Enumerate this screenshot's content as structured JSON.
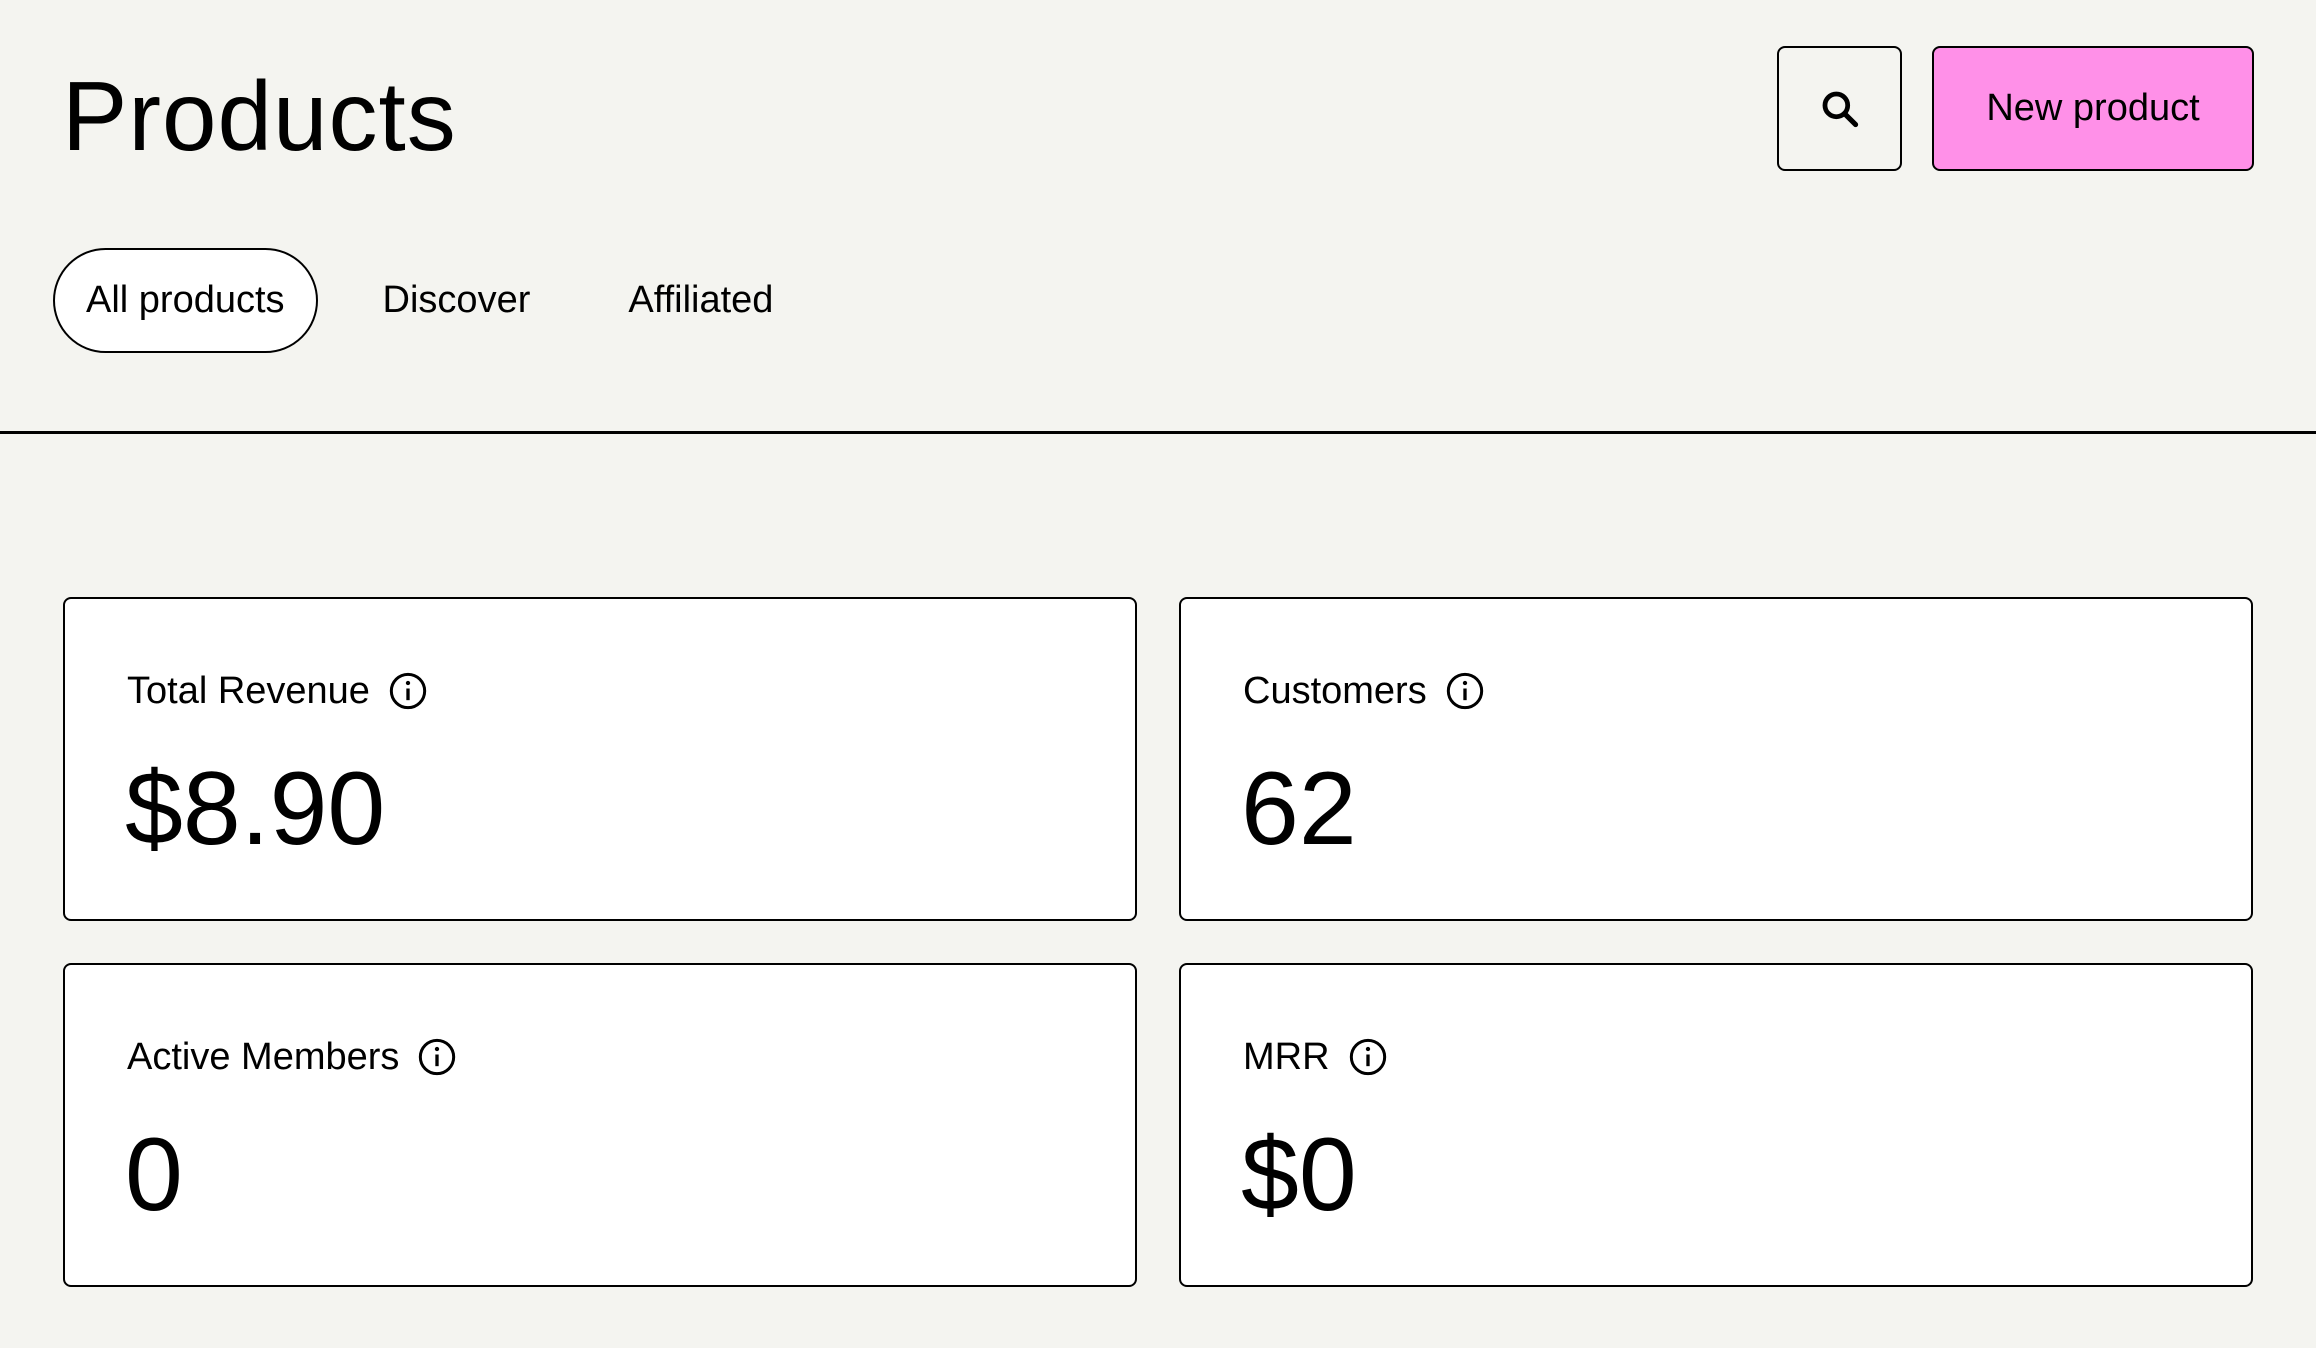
{
  "header": {
    "title": "Products",
    "search_icon": "search-icon",
    "new_product_label": "New product",
    "accent_color": "#ff90e8"
  },
  "tabs": [
    {
      "label": "All products",
      "active": true
    },
    {
      "label": "Discover",
      "active": false
    },
    {
      "label": "Affiliated",
      "active": false
    }
  ],
  "stats": [
    {
      "label": "Total Revenue",
      "value": "$8.90",
      "icon": "info-icon"
    },
    {
      "label": "Customers",
      "value": "62",
      "icon": "info-icon"
    },
    {
      "label": "Active Members",
      "value": "0",
      "icon": "info-icon"
    },
    {
      "label": "MRR",
      "value": "$0",
      "icon": "info-icon"
    }
  ]
}
